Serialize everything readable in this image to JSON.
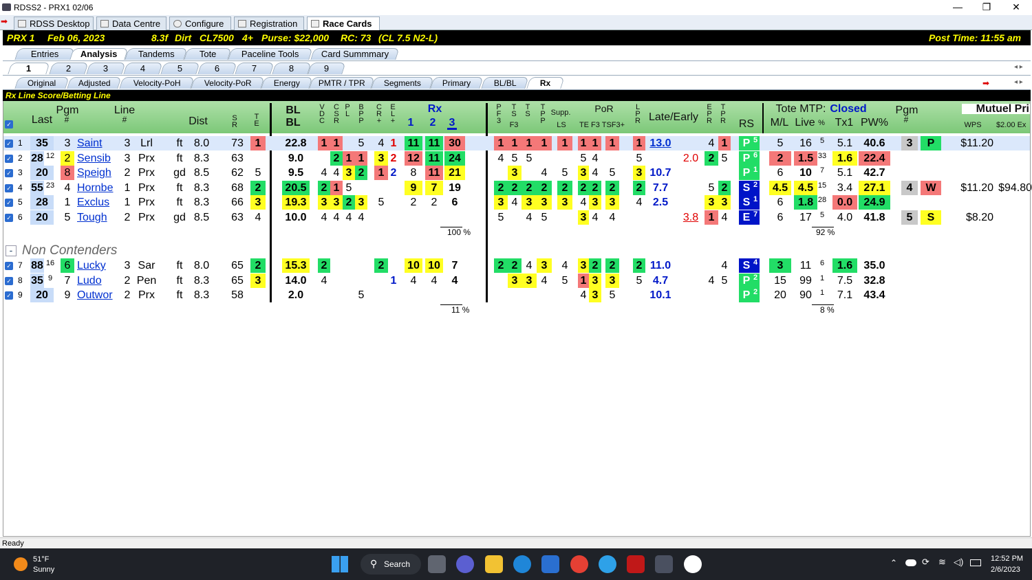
{
  "window": {
    "title": "RDSS2 - PRX1 02/06",
    "min": "—",
    "max": "❐",
    "close": "✕"
  },
  "top_tabs": [
    {
      "label": "RDSS Desktop"
    },
    {
      "label": "Data Centre"
    },
    {
      "label": "Configure"
    },
    {
      "label": "Registration"
    },
    {
      "label": "Race Cards"
    }
  ],
  "race": {
    "id": "PRX 1",
    "date": "Feb 06, 2023",
    "dist": "8.3f",
    "surface": "Dirt",
    "class": "CL7500",
    "age": "4+",
    "purse": "Purse: $22,000",
    "rc": "RC: 73",
    "cl": "(CL 7.5 N2-L)",
    "post_time": "Post Time: 11:55 am"
  },
  "view_tabs": [
    "Entries",
    "Analysis",
    "Tandems",
    "Tote",
    "Paceline Tools",
    "Card Summmary"
  ],
  "race_tabs": [
    "1",
    "2",
    "3",
    "4",
    "5",
    "6",
    "7",
    "8",
    "9"
  ],
  "sub_tabs": [
    "Original",
    "Adjusted",
    "Velocity-PoH",
    "Velocity-PoR",
    "Energy",
    "PMTR / TPR",
    "Segments",
    "Primary",
    "BL/BL",
    "Rx"
  ],
  "section_title": "Rx Line Score/Betting Line",
  "headers": {
    "last": "Last",
    "pgm": "Pgm",
    "pgm_hash": "#",
    "line": "Line",
    "line_hash": "#",
    "dist": "Dist",
    "sr": "S\nR",
    "te": "T\nE",
    "bl1": "BL",
    "bl2": "BL",
    "vdc": "V\nD\nC",
    "csr": "C\nS\nR",
    "pl": "P\nL",
    "bp": "B\nP\nP",
    "cr": "C\nR\n+",
    "el": "E\nL\n+",
    "rx": "Rx",
    "rx1": "1",
    "rx2": "2",
    "rx3": "3",
    "pf3": "P\nF\n3",
    "ts": "T\nS",
    "f3": "F3",
    "tt": "T\nS",
    "tp": "T\nP\nP",
    "supp": "Supp.",
    "ls": "LS",
    "por": "PoR",
    "tef3": "TE F3 TSF3+",
    "lpr": "L\nP\nR",
    "late": "Late/Early",
    "epr": "E\nP\nR",
    "tpr": "T\nP\nR",
    "rs": "RS",
    "tote": "Tote MTP:",
    "tote_status": "Closed",
    "ml": "M/L",
    "live": "Live",
    "pctsym": "%",
    "tx1": "Tx1",
    "pw": "PW%",
    "pgm2": "Pgm",
    "pgm2h": "#",
    "mutuel": "Mutuel Pri",
    "wps": "WPS",
    "ex": "$2.00 Ex"
  },
  "contenders": [
    {
      "n": "1",
      "last": "35",
      "lastsup": "",
      "pgm": "3",
      "name": "Saint",
      "line": "3",
      "trk": "Lrl",
      "sfc": "ft",
      "dist": "8.0",
      "sr": "73",
      "te": "1",
      "bl": "22.8",
      "v": "1",
      "c": "1",
      "p": "",
      "b": "5",
      "cr": "4",
      "el": "1",
      "rx1": "11",
      "rx2": "11",
      "rx3": "30",
      "pf": "1",
      "ts": "1",
      "tt": "1",
      "tp": "1",
      "ls": "1",
      "por1": "1",
      "por2": "1",
      "por3": "1",
      "lpr": "1",
      "late": "13.0",
      "early": "",
      "epr": "4",
      "tpr": "1",
      "rs": "P",
      "rsn": "5",
      "ml": "5",
      "live": "16",
      "pc": "5",
      "tx1": "5.1",
      "pw": "40.6",
      "p2": "3",
      "pos": "P",
      "m1": "$11.20",
      "m2": ""
    },
    {
      "n": "2",
      "last": "28",
      "lastsup": "12",
      "pgm": "2",
      "name": "Sensib",
      "line": "3",
      "trk": "Prx",
      "sfc": "ft",
      "dist": "8.3",
      "sr": "63",
      "te": "",
      "bl": "9.0",
      "v": "",
      "c": "2",
      "p": "1",
      "b": "1",
      "cr": "3",
      "el": "2",
      "rx1": "12",
      "rx2": "11",
      "rx3": "24",
      "pf": "4",
      "ts": "5",
      "tt": "5",
      "tp": "",
      "ls": "",
      "por1": "5",
      "por2": "4",
      "por3": "",
      "lpr": "5",
      "late": "",
      "early": "2.0",
      "epr": "2",
      "tpr": "5",
      "rs": "P",
      "rsn": "6",
      "ml": "2",
      "live": "1.5",
      "pc": "33",
      "tx1": "1.6",
      "pw": "22.4",
      "p2": "",
      "pos": "",
      "m1": "",
      "m2": ""
    },
    {
      "n": "3",
      "last": "20",
      "lastsup": "",
      "pgm": "8",
      "name": "Speigh",
      "line": "2",
      "trk": "Prx",
      "sfc": "gd",
      "dist": "8.5",
      "sr": "62",
      "te": "5",
      "bl": "9.5",
      "v": "4",
      "c": "4",
      "p": "3",
      "b": "2",
      "cr": "1",
      "el": "2",
      "rx1": "8",
      "rx2": "11",
      "rx3": "21",
      "pf": "",
      "ts": "3",
      "tt": "",
      "tp": "4",
      "ls": "5",
      "por1": "3",
      "por2": "4",
      "por3": "5",
      "lpr": "3",
      "late": "10.7",
      "early": "",
      "epr": "",
      "tpr": "",
      "rs": "P",
      "rsn": "1",
      "ml": "6",
      "live": "10",
      "pc": "7",
      "tx1": "5.1",
      "pw": "42.7",
      "p2": "",
      "pos": "",
      "m1": "",
      "m2": ""
    },
    {
      "n": "4",
      "last": "55",
      "lastsup": "23",
      "pgm": "4",
      "name": "Hornbe",
      "line": "1",
      "trk": "Prx",
      "sfc": "ft",
      "dist": "8.3",
      "sr": "68",
      "te": "2",
      "bl": "20.5",
      "v": "2",
      "c": "1",
      "p": "5",
      "b": "",
      "cr": "",
      "el": "",
      "rx1": "9",
      "rx2": "7",
      "rx3": "19",
      "pf": "2",
      "ts": "2",
      "tt": "2",
      "tp": "2",
      "ls": "2",
      "por1": "2",
      "por2": "2",
      "por3": "2",
      "lpr": "2",
      "late": "7.7",
      "early": "",
      "epr": "5",
      "tpr": "2",
      "rs": "S",
      "rsn": "2",
      "ml": "4.5",
      "live": "4.5",
      "pc": "15",
      "tx1": "3.4",
      "pw": "27.1",
      "p2": "4",
      "pos": "W",
      "m1": "$11.20",
      "m2": "$94.80"
    },
    {
      "n": "5",
      "last": "28",
      "lastsup": "",
      "pgm": "1",
      "name": "Exclus",
      "line": "1",
      "trk": "Prx",
      "sfc": "ft",
      "dist": "8.3",
      "sr": "66",
      "te": "3",
      "bl": "19.3",
      "v": "3",
      "c": "3",
      "p": "2",
      "b": "3",
      "cr": "5",
      "el": "",
      "rx1": "2",
      "rx2": "2",
      "rx3": "6",
      "pf": "3",
      "ts": "4",
      "tt": "3",
      "tp": "3",
      "ls": "3",
      "por1": "4",
      "por2": "3",
      "por3": "3",
      "lpr": "4",
      "late": "2.5",
      "early": "",
      "epr": "3",
      "tpr": "3",
      "rs": "S",
      "rsn": "1",
      "ml": "6",
      "live": "1.8",
      "pc": "28",
      "tx1": "0.0",
      "pw": "24.9",
      "p2": "",
      "pos": "",
      "m1": "",
      "m2": ""
    },
    {
      "n": "6",
      "last": "20",
      "lastsup": "",
      "pgm": "5",
      "name": "Tough",
      "line": "2",
      "trk": "Prx",
      "sfc": "gd",
      "dist": "8.5",
      "sr": "63",
      "te": "4",
      "bl": "10.0",
      "v": "4",
      "c": "4",
      "p": "4",
      "b": "4",
      "cr": "",
      "el": "",
      "rx1": "",
      "rx2": "",
      "rx3": "",
      "pf": "5",
      "ts": "",
      "tt": "4",
      "tp": "5",
      "ls": "",
      "por1": "3",
      "por2": "4",
      "por3": "4",
      "lpr": "",
      "late": "",
      "early": "3.8",
      "epr": "1",
      "tpr": "4",
      "rs": "E",
      "rsn": "7",
      "ml": "6",
      "live": "17",
      "pc": "5",
      "tx1": "4.0",
      "pw": "41.8",
      "p2": "5",
      "pos": "S",
      "m1": "$8.20",
      "m2": ""
    }
  ],
  "pct1": "100 %",
  "pct2": "92 %",
  "non_contenders_label": "Non Contenders",
  "non_contenders": [
    {
      "n": "7",
      "last": "88",
      "lastsup": "16",
      "pgm": "6",
      "name": "Lucky",
      "line": "3",
      "trk": "Sar",
      "sfc": "ft",
      "dist": "8.0",
      "sr": "65",
      "te": "2",
      "bl": "15.3",
      "v": "2",
      "cr": "2",
      "rx1": "10",
      "rx2": "10",
      "rx3": "7",
      "pf": "2",
      "ts": "2",
      "tt": "4",
      "tp": "3",
      "ls": "4",
      "por1": "3",
      "por2": "2",
      "por3": "2",
      "lpr": "2",
      "late": "11.0",
      "early": "",
      "epr": "",
      "tpr": "4",
      "rs": "S",
      "rsn": "4",
      "ml": "3",
      "live": "11",
      "pc": "6",
      "tx1": "1.6",
      "pw": "35.0"
    },
    {
      "n": "8",
      "last": "35",
      "lastsup": "9",
      "pgm": "7",
      "name": "Ludo",
      "line": "2",
      "trk": "Pen",
      "sfc": "ft",
      "dist": "8.3",
      "sr": "65",
      "te": "3",
      "bl": "14.0",
      "v": "4",
      "cr": "",
      "el": "1",
      "rx1": "4",
      "rx2": "4",
      "rx3": "4",
      "pf": "",
      "ts": "3",
      "tt": "3",
      "tp": "4",
      "ls": "5",
      "por1": "1",
      "por2": "3",
      "por3": "3",
      "lpr": "5",
      "late": "4.7",
      "early": "",
      "epr": "4",
      "tpr": "5",
      "rs": "P",
      "rsn": "2",
      "ml": "15",
      "live": "99",
      "pc": "1",
      "tx1": "7.5",
      "pw": "32.8"
    },
    {
      "n": "9",
      "last": "20",
      "lastsup": "",
      "pgm": "9",
      "name": "Outwor",
      "line": "2",
      "trk": "Prx",
      "sfc": "ft",
      "dist": "8.3",
      "sr": "58",
      "te": "",
      "bl": "2.0",
      "v": "",
      "b": "5",
      "por1": "4",
      "por2": "3",
      "por3": "5",
      "late": "10.1",
      "rs": "P",
      "rsn": "2",
      "ml": "20",
      "live": "90",
      "pc": "1",
      "tx1": "7.1",
      "pw": "43.4"
    }
  ],
  "pct3": "11 %",
  "pct4": "8 %",
  "status": "Ready",
  "taskbar": {
    "temp": "51°F",
    "weather": "Sunny",
    "search": "Search",
    "time": "12:52 PM",
    "date": "2/6/2023"
  }
}
